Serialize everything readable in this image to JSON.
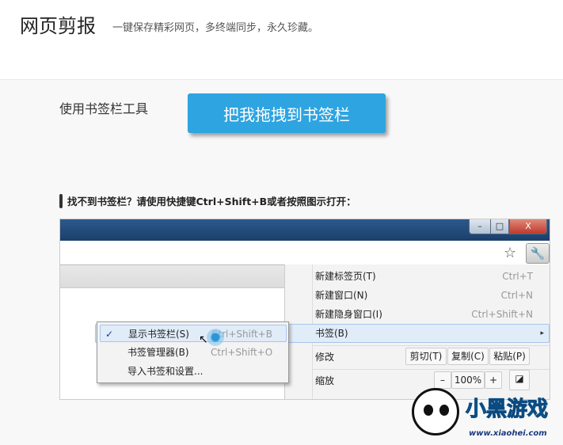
{
  "header": {
    "title": "网页剪报",
    "subtitle": "一键保存精彩网页，多终端同步，永久珍藏。"
  },
  "tool": {
    "label": "使用书签栏工具",
    "button": "把我拖拽到书签栏"
  },
  "hint": "找不到书签栏？请使用快捷键Ctrl+Shift+B或者按照图示打开：",
  "screenshot": {
    "window_buttons": [
      "–",
      "□",
      "X"
    ],
    "menu": [
      {
        "label": "新建标签页(T)",
        "shortcut": "Ctrl+T"
      },
      {
        "label": "新建窗口(N)",
        "shortcut": "Ctrl+N"
      },
      {
        "label": "新建隐身窗口(I)",
        "shortcut": "Ctrl+Shift+N"
      },
      {
        "label": "书签(B)",
        "shortcut": "▸"
      }
    ],
    "edit": {
      "label": "修改",
      "cut": "剪切(T)",
      "copy": "复制(C)",
      "paste": "粘贴(P)"
    },
    "zoom": {
      "label": "缩放",
      "minus": "–",
      "value": "100%",
      "plus": "+"
    },
    "submenu": [
      {
        "check": "✓",
        "label": "显示书签栏(S)",
        "shortcut": "Ctrl+Shift+B"
      },
      {
        "check": "",
        "label": "书签管理器(B)",
        "shortcut": "Ctrl+Shift+O"
      },
      {
        "check": "",
        "label": "导入书签和设置...",
        "shortcut": ""
      }
    ]
  },
  "watermark": {
    "name": "小黑游戏",
    "url": "www.xiaohei.com"
  }
}
